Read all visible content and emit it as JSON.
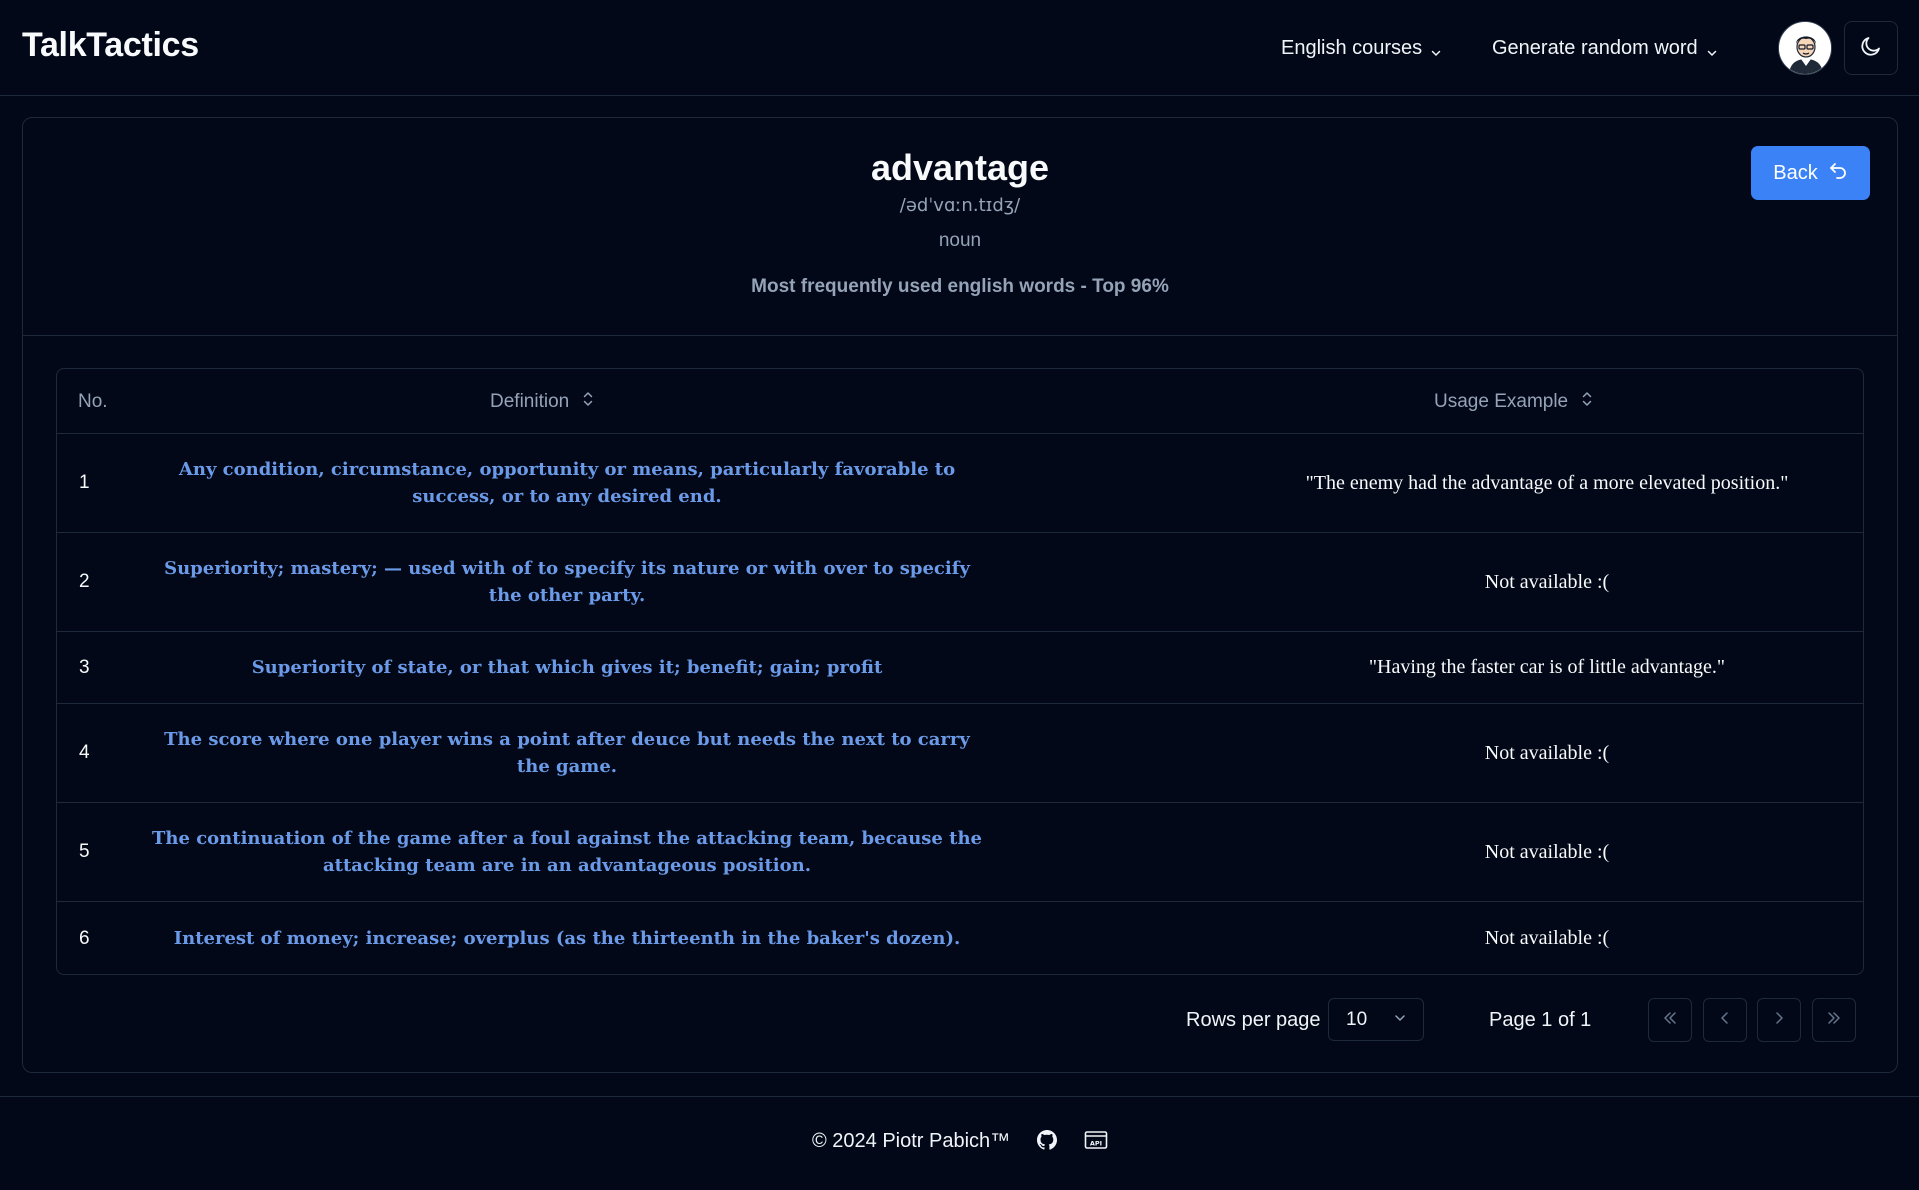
{
  "header": {
    "brand": "TalkTactics",
    "menus": [
      {
        "label": "English courses",
        "icon": "chevron-down-icon"
      },
      {
        "label": "Generate random word",
        "icon": "chevron-down-icon"
      }
    ],
    "avatar_icon": "user-avatar",
    "theme_icon": "moon-icon"
  },
  "word": {
    "title": "advantage",
    "phonetic": "/ədˈvɑːn.tɪdʒ/",
    "part_of_speech": "noun",
    "frequency": "Most frequently used english words - Top 96%",
    "back_label": "Back",
    "back_icon": "undo-arrow-icon"
  },
  "table": {
    "headers": {
      "no": "No.",
      "definition": "Definition",
      "usage": "Usage Example"
    },
    "sort_icon": "chevrons-up-down-icon",
    "rows": [
      {
        "no": "1",
        "definition": "Any condition, circumstance, opportunity or means, particularly favorable to success, or to any desired end.",
        "usage": "\"The enemy had the advantage of a more elevated position.\""
      },
      {
        "no": "2",
        "definition": "Superiority; mastery; — used with of to specify its nature or with over to specify the other party.",
        "usage": "Not available :("
      },
      {
        "no": "3",
        "definition": "Superiority of state, or that which gives it; benefit; gain; profit",
        "usage": "\"Having the faster car is of little advantage.\""
      },
      {
        "no": "4",
        "definition": "The score where one player wins a point after deuce but needs the next to carry the game.",
        "usage": "Not available :("
      },
      {
        "no": "5",
        "definition": "The continuation of the game after a foul against the attacking team, because the attacking team are in an advantageous position.",
        "usage": "Not available :("
      },
      {
        "no": "6",
        "definition": "Interest of money; increase; overplus (as the thirteenth in the baker's dozen).",
        "usage": "Not available :("
      }
    ]
  },
  "pagination": {
    "rows_per_page_label": "Rows per page",
    "rows_per_page_value": "10",
    "page_info": "Page 1 of 1",
    "buttons": [
      "first-page-icon",
      "previous-page-icon",
      "next-page-icon",
      "last-page-icon"
    ]
  },
  "footer": {
    "copyright": "© 2024 Piotr Pabich™",
    "icons": [
      "github-icon",
      "api-icon"
    ]
  },
  "colors": {
    "background": "#020817",
    "border": "#1e293b",
    "accent": "#3b82f6",
    "definition_text": "#6b9be8",
    "muted_text": "#94a3b8"
  }
}
